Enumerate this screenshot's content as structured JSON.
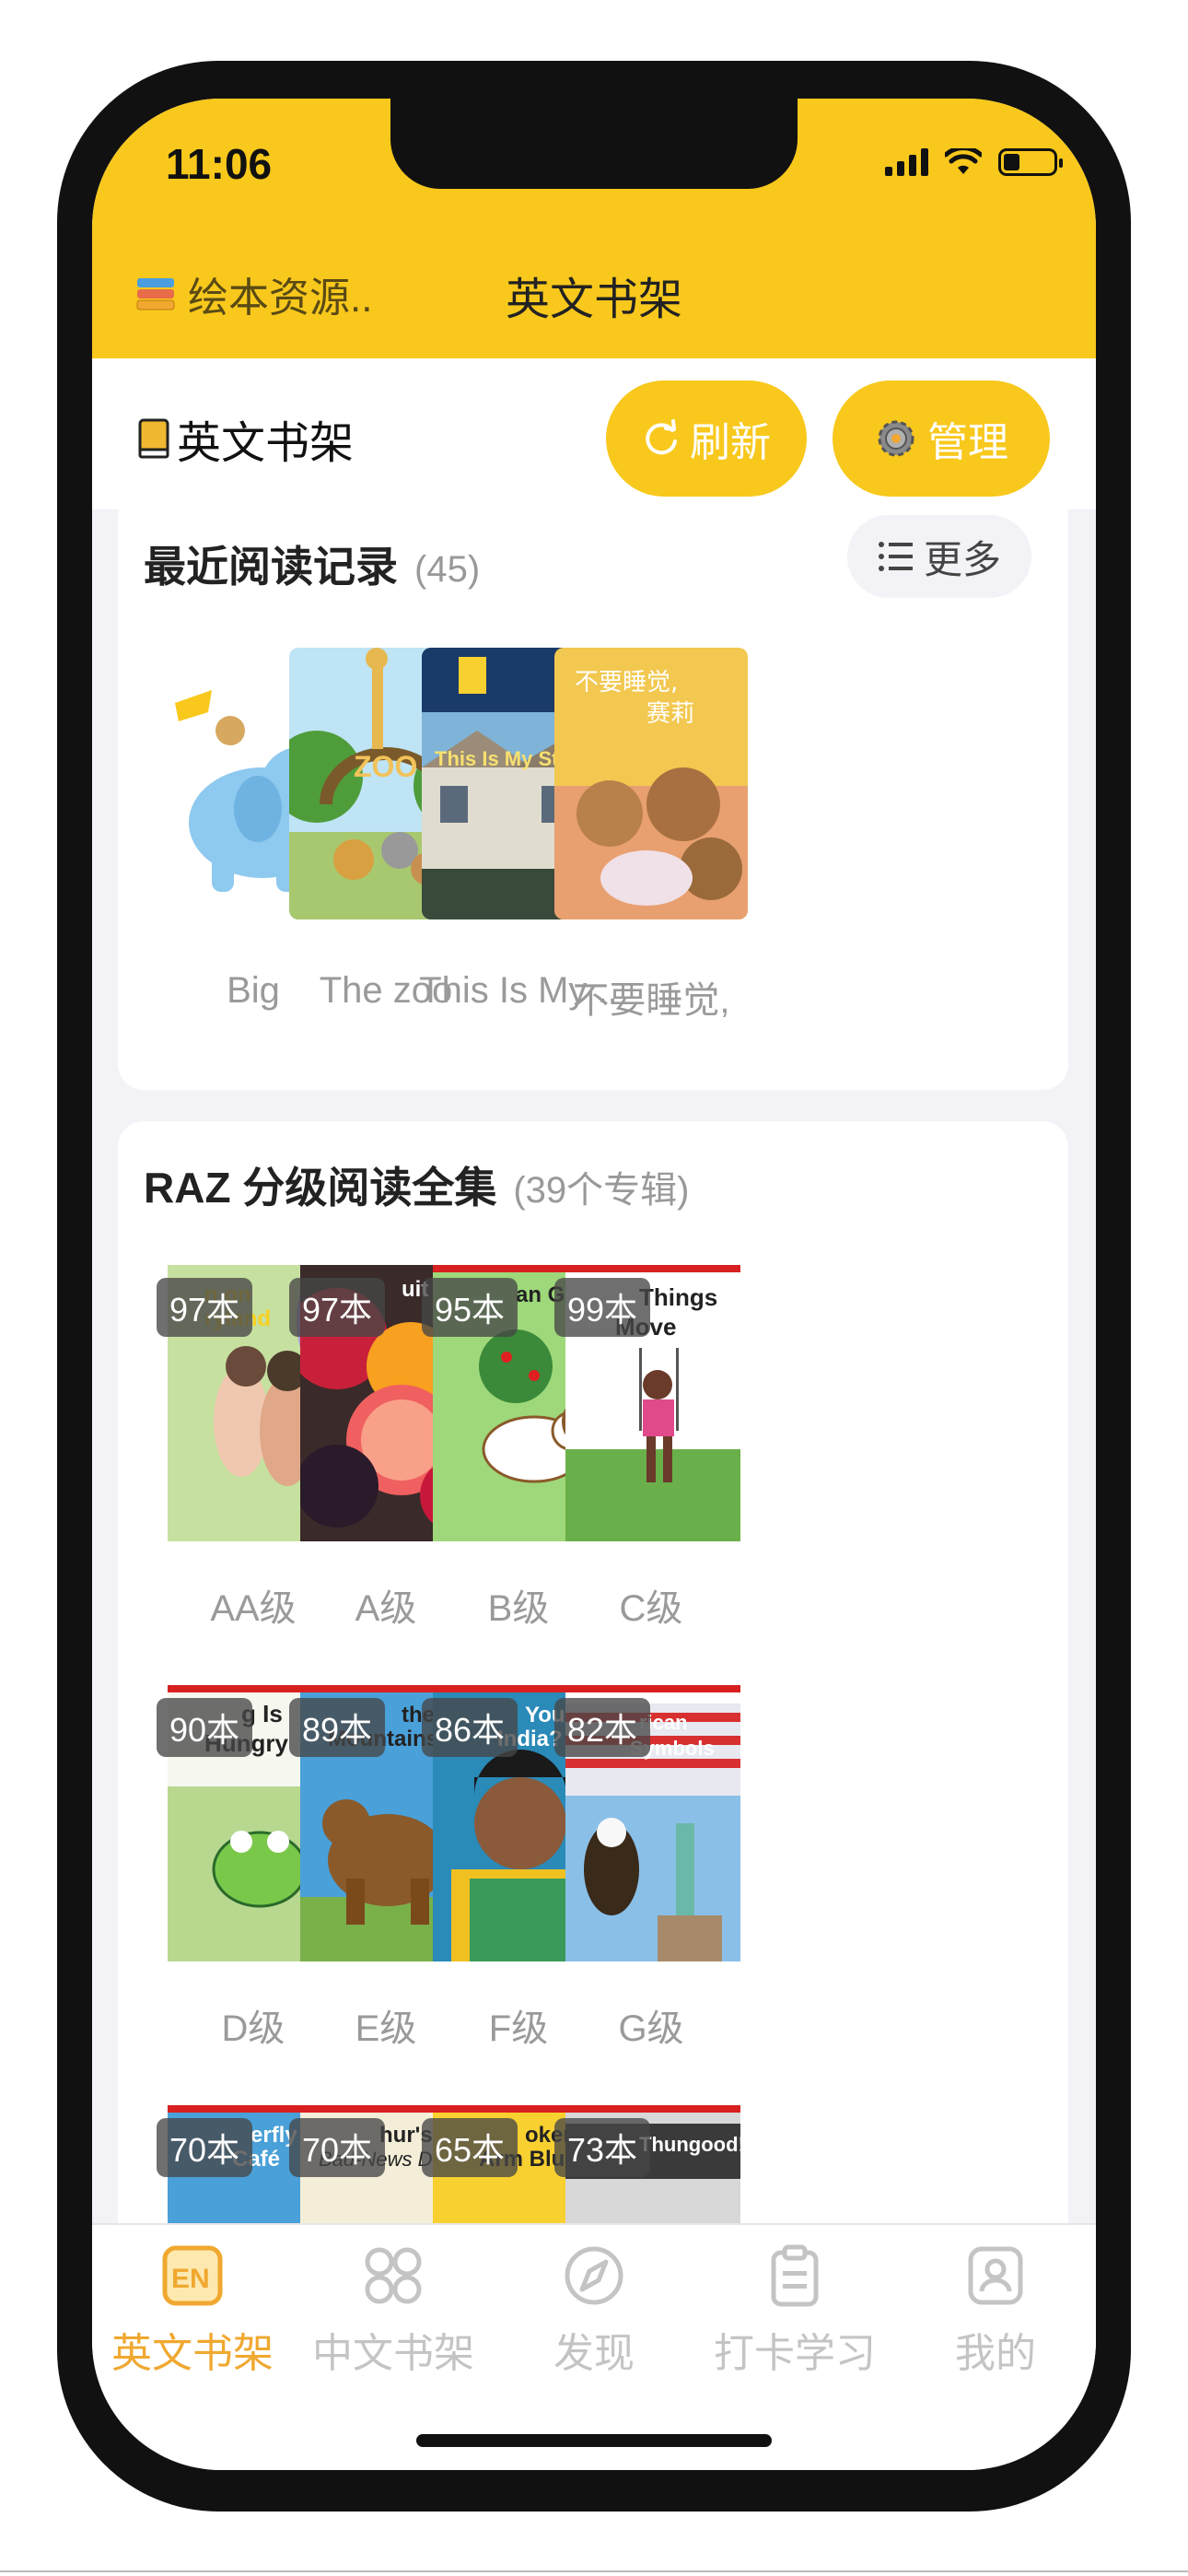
{
  "status_bar": {
    "time": "11:06"
  },
  "header": {
    "source_label": "绘本资源..",
    "title": "英文书架"
  },
  "toolbar": {
    "shelf_title": "英文书架",
    "refresh_label": "刷新",
    "manage_label": "管理"
  },
  "recent": {
    "title": "最近阅读记录",
    "count": "(45)",
    "more_label": "更多",
    "books": [
      {
        "label": "Big"
      },
      {
        "label": "The zoo"
      },
      {
        "label": "This Is My .."
      },
      {
        "label": "不要睡觉,"
      }
    ]
  },
  "raz": {
    "title": "RAZ 分级阅读全集",
    "count": "(39个专辑)",
    "levels": [
      {
        "count": "97本",
        "label": "AA级"
      },
      {
        "count": "97本",
        "label": "A级"
      },
      {
        "count": "95本",
        "label": "B级"
      },
      {
        "count": "99本",
        "label": "C级"
      },
      {
        "count": "90本",
        "label": "D级"
      },
      {
        "count": "89本",
        "label": "E级"
      },
      {
        "count": "86本",
        "label": "F级"
      },
      {
        "count": "82本",
        "label": "G级"
      },
      {
        "count": "70本",
        "label": ""
      },
      {
        "count": "70本",
        "label": ""
      },
      {
        "count": "65本",
        "label": ""
      },
      {
        "count": "73本",
        "label": ""
      }
    ]
  },
  "tabbar": {
    "items": [
      {
        "label": "英文书架",
        "icon": "en-icon",
        "active": true
      },
      {
        "label": "中文书架",
        "icon": "grid-icon",
        "active": false
      },
      {
        "label": "发现",
        "icon": "compass-icon",
        "active": false
      },
      {
        "label": "打卡学习",
        "icon": "clipboard-icon",
        "active": false
      },
      {
        "label": "我的",
        "icon": "profile-icon",
        "active": false
      }
    ]
  },
  "colors": {
    "accent": "#f8c81c",
    "tab_active": "#f0a830",
    "tab_inactive": "#c4c4c4"
  }
}
